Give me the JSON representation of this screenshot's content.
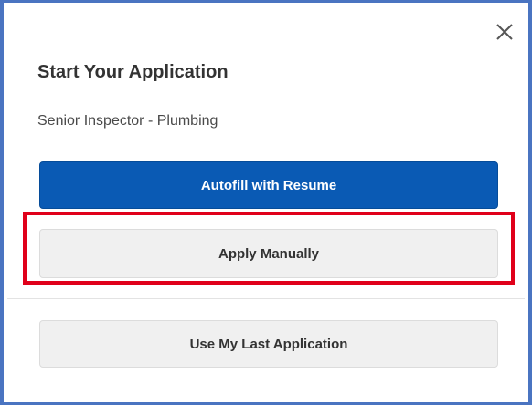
{
  "dialog": {
    "title": "Start Your Application",
    "subtitle": "Senior Inspector - Plumbing",
    "close_icon": "close-icon",
    "buttons": {
      "autofill_label": "Autofill with Resume",
      "manual_label": "Apply Manually",
      "last_application_label": "Use My Last Application"
    }
  },
  "colors": {
    "primary_button": "#0a5ab4",
    "highlight_box": "#e0001a",
    "dialog_border": "#4a74c1"
  }
}
